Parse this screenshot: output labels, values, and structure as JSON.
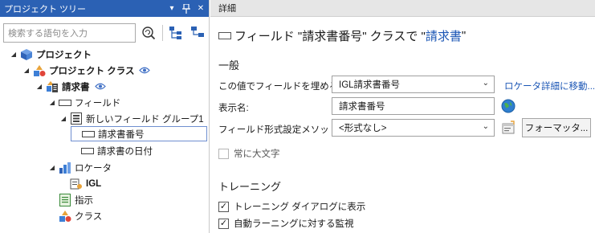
{
  "left_panel": {
    "title": "プロジェクト ツリー",
    "pin_glyph": "▾",
    "dock_glyph": "ᴨ",
    "close_glyph": "✕",
    "search_placeholder": "検索する語句を入力",
    "tree": [
      {
        "label": "プロジェクト",
        "bold": true,
        "icon": "cube-icon"
      },
      {
        "label": "プロジェクト クラス",
        "bold": true,
        "icon": "class-shapes-icon",
        "eye": true
      },
      {
        "label": "請求書",
        "bold": true,
        "icon": "document-class-icon",
        "eye": true
      },
      {
        "label": "フィールド",
        "bold": false,
        "icon": "field-icon"
      },
      {
        "label": "新しいフィールド グループ1",
        "bold": false,
        "icon": "field-group-icon"
      },
      {
        "label": "請求書番号",
        "bold": false,
        "icon": "field-icon",
        "selected": true
      },
      {
        "label": "請求書の日付",
        "bold": false,
        "icon": "field-icon"
      },
      {
        "label": "ロケータ",
        "bold": false,
        "icon": "locator-icon"
      },
      {
        "label": "IGL",
        "bold": false,
        "icon": "igl-icon"
      },
      {
        "label": "指示",
        "bold": false,
        "icon": "instructions-icon"
      },
      {
        "label": "クラス",
        "bold": false,
        "icon": "class-shapes-icon"
      }
    ]
  },
  "details": {
    "header": "詳細",
    "title_prefix": "フィールド \"請求書番号\" クラスで \"",
    "title_link": "請求書",
    "title_suffix": "\"",
    "general_section": "一般",
    "fill_label": "この値でフィールドを埋める:",
    "fill_value": "IGL請求書番号",
    "locator_link": "ロケータ詳細に移動...",
    "display_label": "表示名:",
    "display_value": "請求書番号",
    "format_label": "フィールド形式設定メソッド:",
    "format_value": "<形式なし>",
    "formatter_button": "フォーマッタ...",
    "always_upper": "常に大文字",
    "always_upper_checked": false,
    "training_section": "トレーニング",
    "training_dialog": "トレーニング ダイアログに表示",
    "training_dialog_checked": true,
    "auto_learning": "自動ラーニングに対する監視",
    "auto_learning_checked": true
  }
}
